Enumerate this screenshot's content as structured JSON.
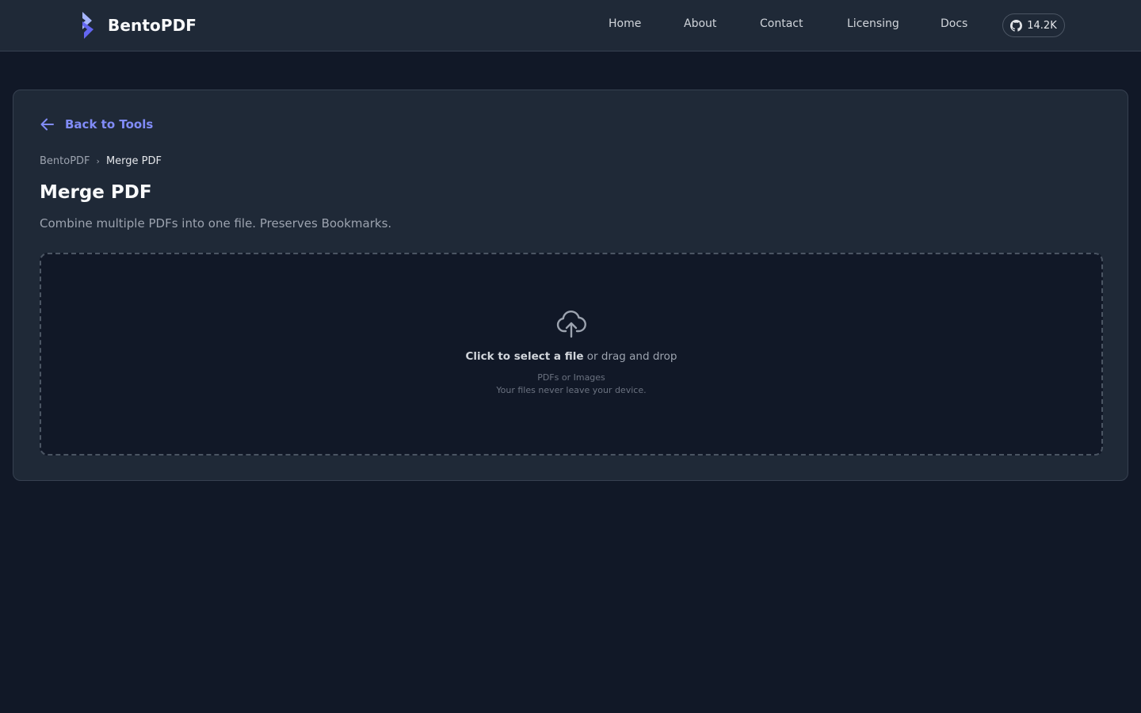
{
  "header": {
    "brand_name": "BentoPDF",
    "nav": [
      {
        "label": "Home"
      },
      {
        "label": "About"
      },
      {
        "label": "Contact"
      },
      {
        "label": "Licensing"
      },
      {
        "label": "Docs"
      }
    ],
    "github_count": "14.2K"
  },
  "tool": {
    "back_label": "Back to Tools",
    "breadcrumb": {
      "home": "BentoPDF",
      "separator": "›",
      "current": "Merge PDF"
    },
    "title": "Merge PDF",
    "description": "Combine multiple PDFs into one file. Preserves Bookmarks."
  },
  "dropzone": {
    "cta_strong": "Click to select a file",
    "cta_rest": " or drag and drop",
    "accepted": "PDFs or Images",
    "privacy": "Your files never leave your device."
  },
  "icons": {
    "logo": "bento-logo-icon",
    "github": "github-icon",
    "back": "arrow-left-icon",
    "upload": "cloud-upload-icon"
  },
  "colors": {
    "background": "#111827",
    "surface": "#1f2937",
    "border": "#374151",
    "accent": "#818cf8",
    "logo_primary": "#6366f1",
    "logo_secondary": "#a5b4fc"
  }
}
